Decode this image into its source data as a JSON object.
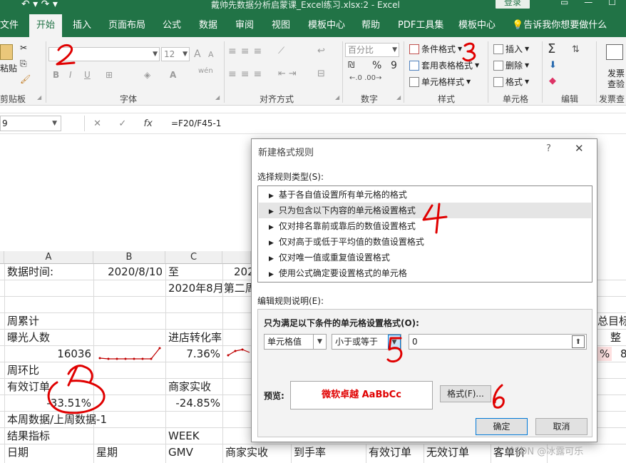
{
  "titlebar": {
    "title": "戴帅先数据分析启蒙课_Excel练习.xlsx:2  -  Excel",
    "login": "登录",
    "undo": "↶ ▾ ↷ ▾"
  },
  "tabs": [
    "文件",
    "开始",
    "插入",
    "页面布局",
    "公式",
    "数据",
    "审阅",
    "视图",
    "模板中心",
    "帮助",
    "PDF工具集",
    "模板中心",
    "告诉我你想要做什么"
  ],
  "ribbon": {
    "clipboard": {
      "paste": "粘贴",
      "label": "剪贴板"
    },
    "font": {
      "size": "12",
      "label": "字体",
      "bold": "B",
      "italic": "I",
      "underline": "U",
      "grow": "A",
      "shrink": "A",
      "wen": "wén"
    },
    "align": {
      "label": "对齐方式"
    },
    "number": {
      "format": "百分比",
      "label": "数字",
      "percent": "%",
      "comma": "9"
    },
    "styles": {
      "cond": "条件格式",
      "table": "套用表格格式",
      "cell": "单元格样式",
      "label": "样式"
    },
    "cells": {
      "insert": "插入",
      "delete": "删除",
      "format": "格式",
      "label": "单元格"
    },
    "edit": {
      "label": "编辑",
      "sigma": "Σ"
    },
    "publish": {
      "line1": "发票",
      "line2": "查验",
      "label": "发票查"
    }
  },
  "formula_bar": {
    "name": "9",
    "cancel": "✕",
    "enter": "✓",
    "fx": "fx",
    "formula": "=F20/F45-1"
  },
  "sheet": {
    "cols": [
      "A",
      "B",
      "C"
    ],
    "cells": {
      "a1": "数据时间:",
      "b1": "2020/8/10",
      "c1": "至",
      "d1": "202",
      "c2": "2020年8月第二周",
      "a4": "周累计",
      "a5": "曝光人数",
      "c5": "进店转化率",
      "a6": "16036",
      "c6": "7.36%",
      "a7": "周环比",
      "a8": "有效订单",
      "c8": "商家实收",
      "a9": "-33.51%",
      "c9": "-24.85%",
      "a10": "本周数据/上周数据-1",
      "a11": "结果指标",
      "c11": "WEEK",
      "h1": "日期",
      "h2": "星期",
      "h3": "GMV",
      "h4": "商家实收",
      "h5": "到手率",
      "h6": "有效订单",
      "h7": "无效订单",
      "h8": "客单价",
      "r1": "总目标",
      "r2": "整",
      "r3": "%",
      "r4": "8"
    }
  },
  "dialog": {
    "title": "新建格式规则",
    "help": "?",
    "close": "✕",
    "select_label": "选择规则类型(S):",
    "rules": [
      "基于各自值设置所有单元格的格式",
      "只为包含以下内容的单元格设置格式",
      "仅对排名靠前或靠后的数值设置格式",
      "仅对高于或低于平均值的数值设置格式",
      "仅对唯一值或重复值设置格式",
      "使用公式确定要设置格式的单元格"
    ],
    "edit_label": "编辑规则说明(E):",
    "cond_label": "只为满足以下条件的单元格设置格式(O):",
    "field1": "单元格值",
    "field2": "小于或等于",
    "value": "0",
    "preview_label": "预览:",
    "preview_text": "微软卓越  AaBbCc",
    "format_btn": "格式(F)...",
    "ok": "确定",
    "cancel": "取消"
  },
  "annotations": [
    "2",
    "3",
    "4",
    "5",
    "6",
    "1"
  ],
  "watermark": "CSDN @冰露可乐",
  "colors": {
    "excel_green": "#217346",
    "annotation_red": "#e00000",
    "spark_red": "#c00000"
  }
}
